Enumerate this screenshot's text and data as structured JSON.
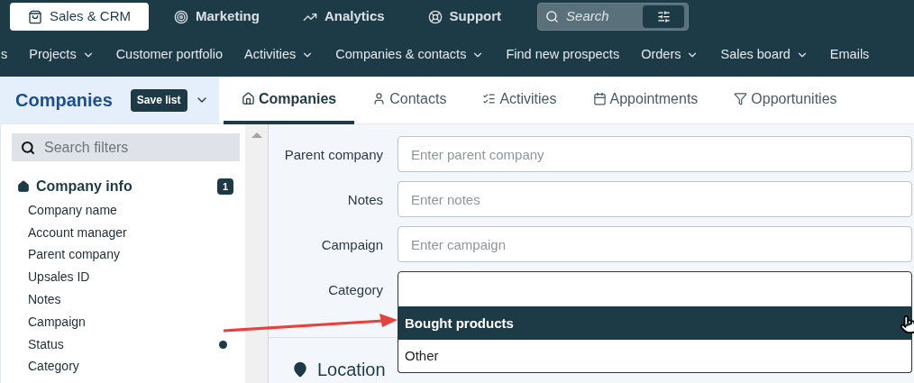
{
  "top_nav": {
    "items": [
      {
        "label": "Sales & CRM",
        "selected": true
      },
      {
        "label": "Marketing",
        "selected": false
      },
      {
        "label": "Analytics",
        "selected": false
      },
      {
        "label": "Support",
        "selected": false
      }
    ],
    "search": {
      "placeholder": "Search"
    }
  },
  "sub_nav": [
    {
      "label": "s",
      "dropdown": false
    },
    {
      "label": "Projects",
      "dropdown": true
    },
    {
      "label": "Customer portfolio",
      "dropdown": false
    },
    {
      "label": "Activities",
      "dropdown": true
    },
    {
      "label": "Companies & contacts",
      "dropdown": true
    },
    {
      "label": "Find new prospects",
      "dropdown": false
    },
    {
      "label": "Orders",
      "dropdown": true
    },
    {
      "label": "Sales board",
      "dropdown": true
    },
    {
      "label": "Emails",
      "dropdown": false
    }
  ],
  "list_header": {
    "title": "Companies",
    "save_button": "Save list"
  },
  "tabs": [
    {
      "label": "Companies",
      "selected": true
    },
    {
      "label": "Contacts",
      "selected": false
    },
    {
      "label": "Activities",
      "selected": false
    },
    {
      "label": "Appointments",
      "selected": false
    },
    {
      "label": "Opportunities",
      "selected": false
    }
  ],
  "sidebar": {
    "search": {
      "placeholder": "Search filters"
    },
    "section": {
      "title": "Company info",
      "badge": "1"
    },
    "items": [
      {
        "label": "Company name",
        "active": false
      },
      {
        "label": "Account manager",
        "active": false
      },
      {
        "label": "Parent company",
        "active": false
      },
      {
        "label": "Upsales ID",
        "active": false
      },
      {
        "label": "Notes",
        "active": false
      },
      {
        "label": "Campaign",
        "active": false
      },
      {
        "label": "Status",
        "active": true
      },
      {
        "label": "Category",
        "active": false
      }
    ]
  },
  "form": {
    "fields": [
      {
        "label": "Parent company",
        "kind": "text",
        "placeholder": "Enter parent company"
      },
      {
        "label": "Notes",
        "kind": "text",
        "placeholder": "Enter notes"
      },
      {
        "label": "Campaign",
        "kind": "text",
        "placeholder": "Enter campaign"
      },
      {
        "label": "Category",
        "kind": "select",
        "options": [
          {
            "label": "Bought products",
            "selected": true
          },
          {
            "label": "Other",
            "selected": false
          }
        ]
      }
    ],
    "section_title": "Location"
  }
}
